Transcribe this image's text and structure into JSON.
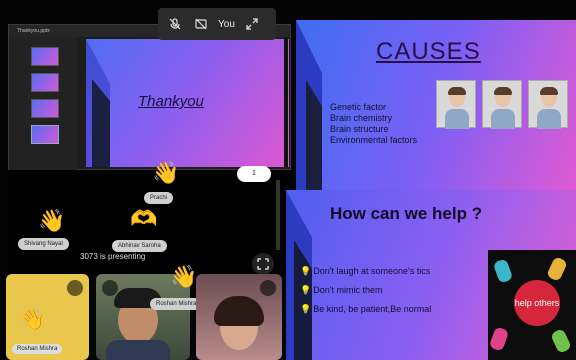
{
  "top_controls": {
    "you_label": "You",
    "icons": [
      "mic-off-icon",
      "camera-off-icon",
      "expand-icon"
    ]
  },
  "presenter_window": {
    "title": "Thankyou.pptx",
    "slide_text": "Thankyou",
    "thumbnail_count": 4
  },
  "meeting": {
    "counter_chip": "1",
    "presenting_text": "3073 is presenting",
    "reactions": [
      {
        "name": "Prachi",
        "emoji": "👋"
      },
      {
        "name": "Shivang Nayal",
        "emoji": "👋"
      },
      {
        "name": "Abhinav Saroha",
        "emoji": "🫶"
      },
      {
        "name": "Roshan Mishra",
        "emoji": "👋"
      }
    ]
  },
  "video_tiles": [
    {
      "name": "Roshan Mishra",
      "color": "#e9c64c"
    },
    {
      "name": "",
      "color": "#5d6b52"
    },
    {
      "name": "",
      "color": "#8c6669"
    }
  ],
  "slide_causes": {
    "title": "CAUSES",
    "items": [
      "Genetic factor",
      "Brain chemistry",
      "Brain structure",
      "Environmental factors"
    ]
  },
  "slide_help": {
    "title": "How can we help ?",
    "items": [
      "Don't laugh at someone's tics",
      "Don't mimic them",
      "Be kind, be patient,Be normal"
    ],
    "image_text": "help others"
  }
}
